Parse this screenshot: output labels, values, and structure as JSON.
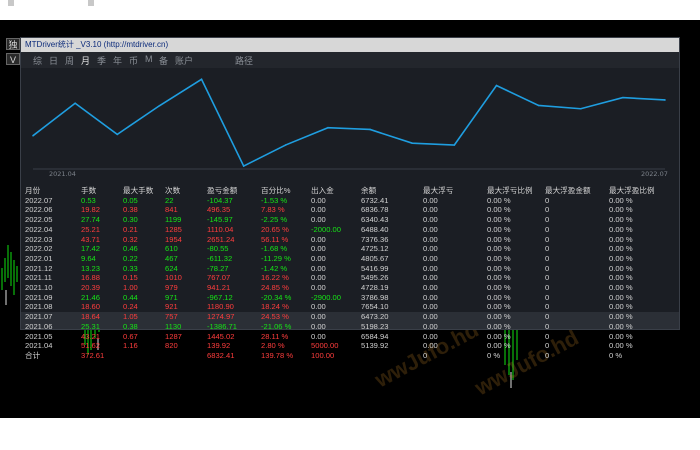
{
  "window": {
    "title": "MTDriver统计 _V3.10 (http://mtdriver.cn)"
  },
  "side_controls": [
    "独",
    "V"
  ],
  "tabs": [
    {
      "label": "综",
      "active": false
    },
    {
      "label": "日",
      "active": false
    },
    {
      "label": "周",
      "active": false
    },
    {
      "label": "月",
      "active": true
    },
    {
      "label": "季",
      "active": false
    },
    {
      "label": "年",
      "active": false
    },
    {
      "label": "币",
      "active": false
    },
    {
      "label": "M",
      "active": false
    },
    {
      "label": "备",
      "active": false
    },
    {
      "label": "账户",
      "active": false
    },
    {
      "label": "路径",
      "active": false
    }
  ],
  "chart_data": {
    "type": "line",
    "x_start_label": "2021.04",
    "x_end_label": "2022.07",
    "x": [
      "2021.04",
      "2021.05",
      "2021.06",
      "2021.07",
      "2021.08",
      "2021.09",
      "2021.10",
      "2021.11",
      "2021.12",
      "2022.01",
      "2022.02",
      "2022.03",
      "2022.04",
      "2022.05",
      "2022.06",
      "2022.07"
    ],
    "values": [
      5139.92,
      6584.94,
      5198.23,
      6473.2,
      7654.1,
      3786.98,
      4728.19,
      5495.26,
      5416.99,
      4805.67,
      4725.12,
      7376.36,
      6488.4,
      6340.43,
      6836.78,
      6732.41
    ],
    "color": "#1f9ee0"
  },
  "table": {
    "columns": [
      "月份",
      "手数",
      "最大手数",
      "次数",
      "盈亏金额",
      "百分比%",
      "出入金",
      "余额",
      "最大浮亏",
      "最大浮亏比例",
      "最大浮盈金额",
      "最大浮盈比例"
    ],
    "rows": [
      {
        "month": "2022.07",
        "lots": "0.53",
        "maxlots": "0.05",
        "count": "22",
        "pnl": "-104.37",
        "pct": "-1.53 %",
        "flow": "0.00",
        "bal": "6732.41",
        "mfl": "0.00",
        "mflp": "0.00 %",
        "mfp": "0",
        "mfpp": "0.00 %",
        "c": "g"
      },
      {
        "month": "2022.06",
        "lots": "19.82",
        "maxlots": "0.38",
        "count": "841",
        "pnl": "496.35",
        "pct": "7.83 %",
        "flow": "0.00",
        "bal": "6836.78",
        "mfl": "0.00",
        "mflp": "0.00 %",
        "mfp": "0",
        "mfpp": "0.00 %",
        "c": "r"
      },
      {
        "month": "2022.05",
        "lots": "27.74",
        "maxlots": "0.30",
        "count": "1199",
        "pnl": "-145.97",
        "pct": "-2.25 %",
        "flow": "0.00",
        "bal": "6340.43",
        "mfl": "0.00",
        "mflp": "0.00 %",
        "mfp": "0",
        "mfpp": "0.00 %",
        "c": "g"
      },
      {
        "month": "2022.04",
        "lots": "25.21",
        "maxlots": "0.21",
        "count": "1285",
        "pnl": "1110.04",
        "pct": "20.65 %",
        "flow": "-2000.00",
        "bal": "6488.40",
        "mfl": "0.00",
        "mflp": "0.00 %",
        "mfp": "0",
        "mfpp": "0.00 %",
        "c": "r"
      },
      {
        "month": "2022.03",
        "lots": "43.71",
        "maxlots": "0.32",
        "count": "1954",
        "pnl": "2651.24",
        "pct": "56.11 %",
        "flow": "0.00",
        "bal": "7376.36",
        "mfl": "0.00",
        "mflp": "0.00 %",
        "mfp": "0",
        "mfpp": "0.00 %",
        "c": "r"
      },
      {
        "month": "2022.02",
        "lots": "17.42",
        "maxlots": "0.46",
        "count": "610",
        "pnl": "-80.55",
        "pct": "-1.68 %",
        "flow": "0.00",
        "bal": "4725.12",
        "mfl": "0.00",
        "mflp": "0.00 %",
        "mfp": "0",
        "mfpp": "0.00 %",
        "c": "g"
      },
      {
        "month": "2022.01",
        "lots": "9.64",
        "maxlots": "0.22",
        "count": "467",
        "pnl": "-611.32",
        "pct": "-11.29 %",
        "flow": "0.00",
        "bal": "4805.67",
        "mfl": "0.00",
        "mflp": "0.00 %",
        "mfp": "0",
        "mfpp": "0.00 %",
        "c": "g"
      },
      {
        "month": "2021.12",
        "lots": "13.23",
        "maxlots": "0.33",
        "count": "624",
        "pnl": "-78.27",
        "pct": "-1.42 %",
        "flow": "0.00",
        "bal": "5416.99",
        "mfl": "0.00",
        "mflp": "0.00 %",
        "mfp": "0",
        "mfpp": "0.00 %",
        "c": "g"
      },
      {
        "month": "2021.11",
        "lots": "16.88",
        "maxlots": "0.15",
        "count": "1010",
        "pnl": "767.07",
        "pct": "16.22 %",
        "flow": "0.00",
        "bal": "5495.26",
        "mfl": "0.00",
        "mflp": "0.00 %",
        "mfp": "0",
        "mfpp": "0.00 %",
        "c": "r"
      },
      {
        "month": "2021.10",
        "lots": "20.39",
        "maxlots": "1.00",
        "count": "979",
        "pnl": "941.21",
        "pct": "24.85 %",
        "flow": "0.00",
        "bal": "4728.19",
        "mfl": "0.00",
        "mflp": "0.00 %",
        "mfp": "0",
        "mfpp": "0.00 %",
        "c": "r"
      },
      {
        "month": "2021.09",
        "lots": "21.46",
        "maxlots": "0.44",
        "count": "971",
        "pnl": "-967.12",
        "pct": "-20.34 %",
        "flow": "-2900.00",
        "bal": "3786.98",
        "mfl": "0.00",
        "mflp": "0.00 %",
        "mfp": "0",
        "mfpp": "0.00 %",
        "c": "g"
      },
      {
        "month": "2021.08",
        "lots": "18.60",
        "maxlots": "0.24",
        "count": "921",
        "pnl": "1180.90",
        "pct": "18.24 %",
        "flow": "0.00",
        "bal": "7654.10",
        "mfl": "0.00",
        "mflp": "0.00 %",
        "mfp": "0",
        "mfpp": "0.00 %",
        "c": "r"
      },
      {
        "month": "2021.07",
        "lots": "18.64",
        "maxlots": "1.05",
        "count": "757",
        "pnl": "1274.97",
        "pct": "24.53 %",
        "flow": "0.00",
        "bal": "6473.20",
        "mfl": "0.00",
        "mflp": "0.00 %",
        "mfp": "0",
        "mfpp": "0.00 %",
        "c": "r"
      },
      {
        "month": "2021.06",
        "lots": "25.31",
        "maxlots": "0.38",
        "count": "1130",
        "pnl": "-1386.71",
        "pct": "-21.06 %",
        "flow": "0.00",
        "bal": "5198.23",
        "mfl": "0.00",
        "mflp": "0.00 %",
        "mfp": "0",
        "mfpp": "0.00 %",
        "c": "g"
      },
      {
        "month": "2021.05",
        "lots": "43.21",
        "maxlots": "0.67",
        "count": "1287",
        "pnl": "1445.02",
        "pct": "28.11 %",
        "flow": "0.00",
        "bal": "6584.94",
        "mfl": "0.00",
        "mflp": "0.00 %",
        "mfp": "0",
        "mfpp": "0.00 %",
        "c": "r"
      },
      {
        "month": "2021.04",
        "lots": "51.62",
        "maxlots": "1.16",
        "count": "820",
        "pnl": "139.92",
        "pct": "2.80 %",
        "flow": "5000.00",
        "bal": "5139.92",
        "mfl": "0.00",
        "mflp": "0.00 %",
        "mfp": "0",
        "mfpp": "0.00 %",
        "c": "r"
      }
    ],
    "total": {
      "label": "合计",
      "lots": "372.61",
      "pnl": "6832.41",
      "pct": "139.78 %",
      "flow": "100.00",
      "mfl": "0",
      "mflp": "0 %",
      "mfp": "0",
      "mfpp": "0 %"
    }
  },
  "watermark": "wwJufo.hd"
}
